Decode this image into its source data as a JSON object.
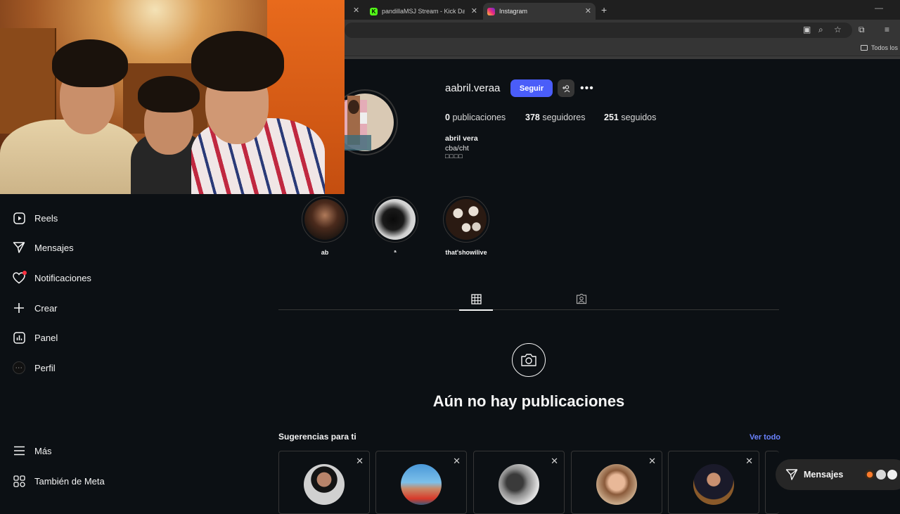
{
  "browser": {
    "tabs": [
      {
        "title": "pandillaMSJ Stream - Kick Dash",
        "close": "✕",
        "active": false
      },
      {
        "title": "Instagram",
        "close": "✕",
        "active": true
      }
    ],
    "first_close": "✕",
    "new_tab": "+",
    "minimize": "—",
    "bookmarks_folder": "Todos los m"
  },
  "sidebar": {
    "items": [
      {
        "label": "Reels",
        "icon": "reels-icon"
      },
      {
        "label": "Mensajes",
        "icon": "messages-icon"
      },
      {
        "label": "Notificaciones",
        "icon": "heart-icon"
      },
      {
        "label": "Crear",
        "icon": "plus-icon"
      },
      {
        "label": "Panel",
        "icon": "dashboard-icon"
      },
      {
        "label": "Perfil",
        "icon": "profile-avatar-icon"
      },
      {
        "label": "Más",
        "icon": "menu-icon"
      },
      {
        "label": "También de Meta",
        "icon": "meta-apps-icon"
      }
    ]
  },
  "profile": {
    "username": "aabril.veraa",
    "follow_label": "Seguir",
    "more": "•••",
    "stats": {
      "posts_count": "0",
      "posts_label": "publicaciones",
      "followers_count": "378",
      "followers_label": "seguidores",
      "following_count": "251",
      "following_label": "seguidos"
    },
    "bio": {
      "name": "abril vera",
      "line": "cba/cht",
      "glyphs": "□□□□"
    }
  },
  "highlights": [
    {
      "label": "ab"
    },
    {
      "label": "ª"
    },
    {
      "label": "that'showilive"
    }
  ],
  "empty_state": {
    "title": "Aún no hay publicaciones"
  },
  "suggestions": {
    "title": "Sugerencias para ti",
    "see_all": "Ver todo",
    "close": "✕"
  },
  "messages_pill": {
    "label": "Mensajes"
  },
  "colors": {
    "background": "#0c1014",
    "accent": "#4a5df9",
    "link": "#6b83ff",
    "notification": "#ff3040"
  }
}
